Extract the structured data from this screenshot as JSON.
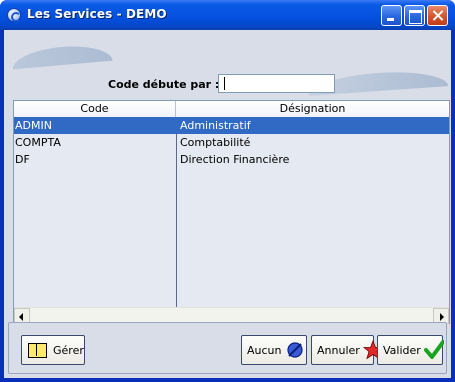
{
  "window": {
    "title": "Les Services - DEMO"
  },
  "filter": {
    "label": "Code débute par :",
    "value": ""
  },
  "grid": {
    "columns": [
      "Code",
      "Désignation"
    ],
    "rows": [
      {
        "code": "ADMIN",
        "designation": "Administratif",
        "selected": true
      },
      {
        "code": "COMPTA",
        "designation": "Comptabilité",
        "selected": false
      },
      {
        "code": "DF",
        "designation": "Direction Financière",
        "selected": false
      }
    ]
  },
  "buttons": {
    "gerer": "Gérer",
    "aucun": "Aucun",
    "annuler": "Annuler",
    "valider": "Valider"
  },
  "icons": {
    "app": "app-icon",
    "gerer": "book-icon",
    "aucun": "no-entry-icon",
    "annuler": "cancel-star-icon",
    "valider": "checkmark-icon"
  },
  "colors": {
    "titlebar": "#0450de",
    "selection": "#316ac5",
    "client": "#d8dde8"
  }
}
